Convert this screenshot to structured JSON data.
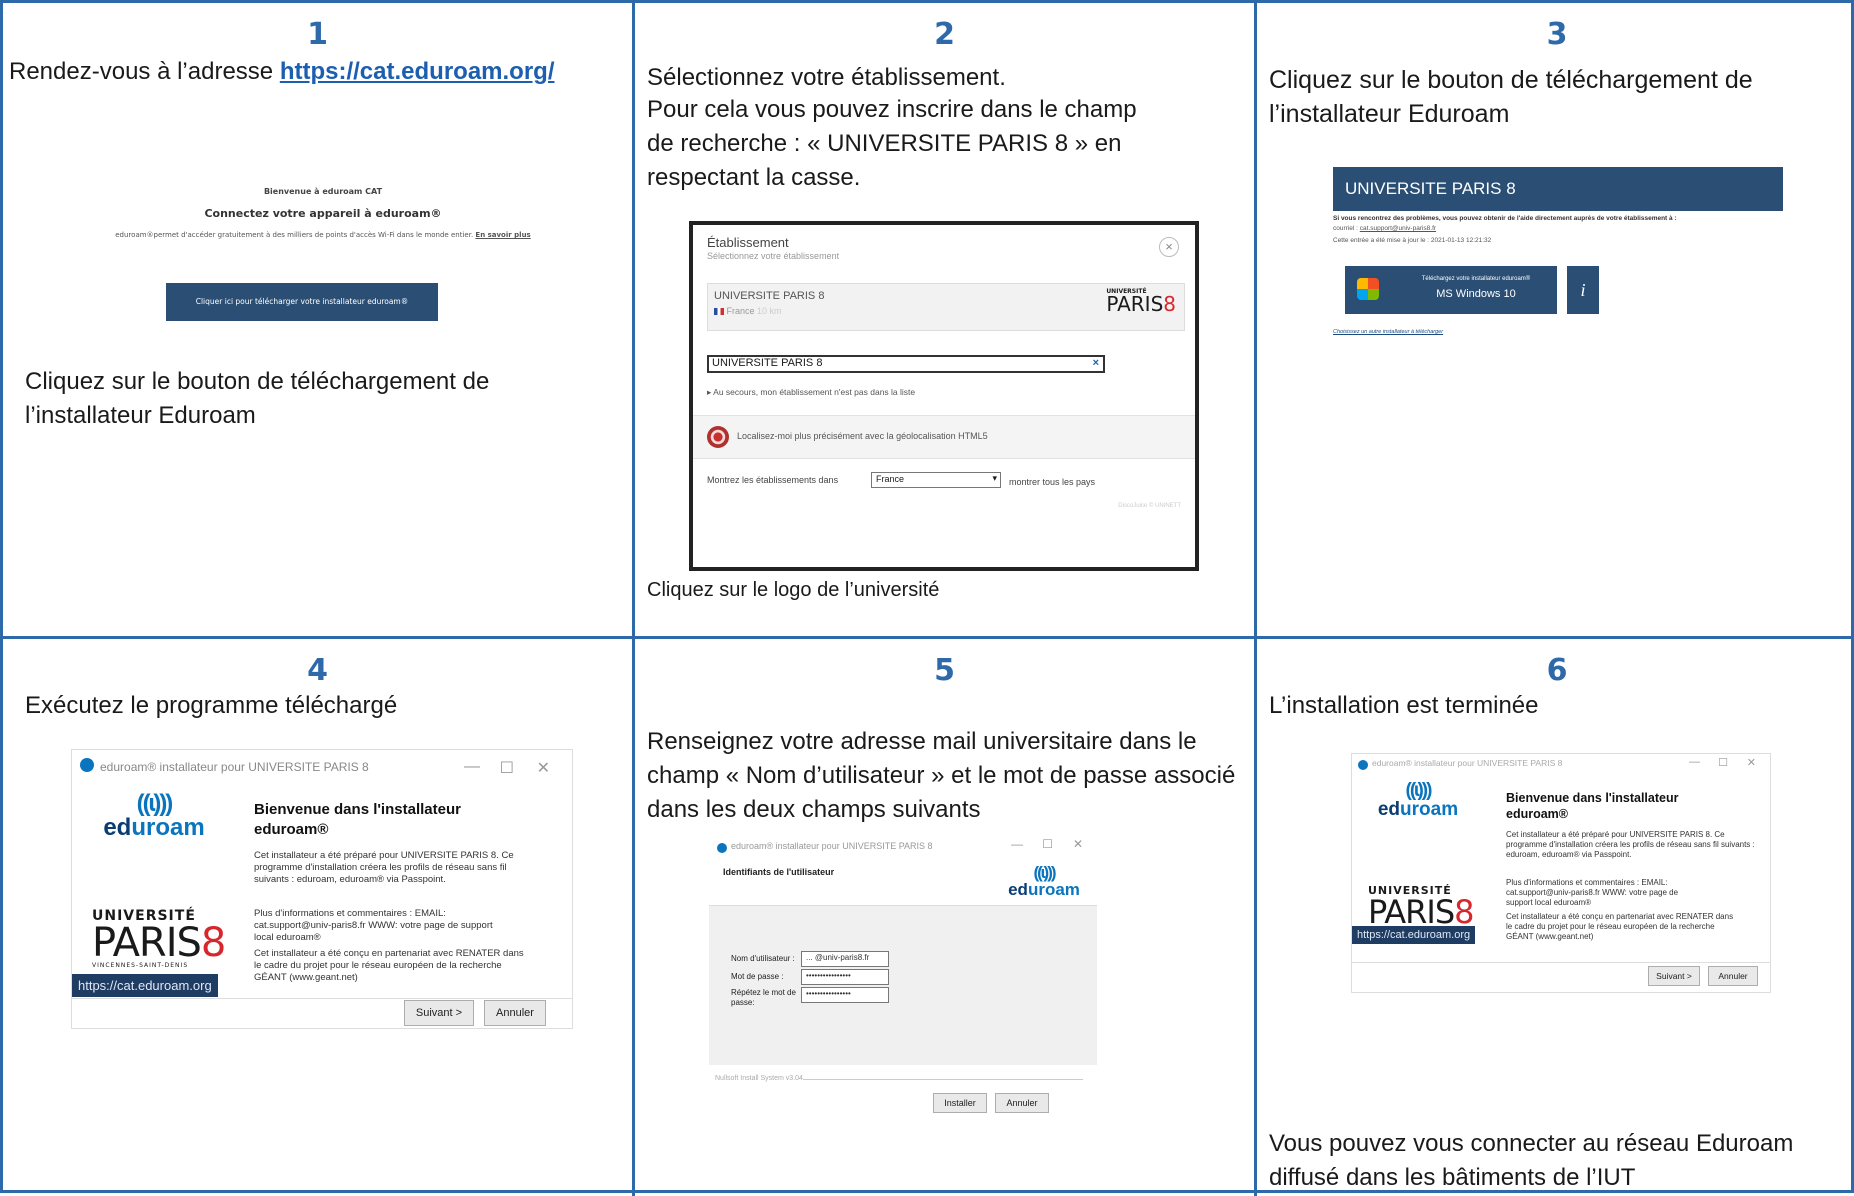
{
  "colors": {
    "accent": "#2e6aa9",
    "link": "#1c5fb0",
    "banner": "#2a4e74",
    "red": "#d8262d"
  },
  "steps": [
    {
      "num": "1",
      "text_prefix": "Rendez-vous à l’adresse ",
      "link": "https://cat.eduroam.org/",
      "text2": "Cliquez sur le bouton de téléchargement de l’installateur Eduroam"
    },
    {
      "num": "2",
      "text": "Sélectionnez votre établissement.",
      "text_b": "Pour cela vous pouvez inscrire dans le champ de recherche : « UNIVERSITE PARIS 8 » en respectant la casse.",
      "caption": "Cliquez sur le logo de l’université"
    },
    {
      "num": "3",
      "text": "Cliquez sur le bouton de téléchargement de l’installateur Eduroam"
    },
    {
      "num": "4",
      "text": "Exécutez le programme téléchargé"
    },
    {
      "num": "5",
      "text": "Renseignez votre adresse mail universitaire dans le champ « Nom d’utilisateur » et le mot de passe associé dans les deux champs suivants"
    },
    {
      "num": "6",
      "text": "L’installation est terminée",
      "text2": "Vous pouvez vous connecter au réseau Eduroam diffusé dans les bâtiments de l’IUT"
    }
  ],
  "shot1": {
    "welcome": "Bienvenue à eduroam CAT",
    "heading": "Connectez votre appareil à eduroam®",
    "desc": "eduroam®permet d'accéder gratuitement à des milliers de points d'accès Wi-Fi dans le monde entier.",
    "more": "En savoir plus",
    "button": "Cliquer ici pour télécharger votre installateur eduroam®"
  },
  "shot2": {
    "title": "Établissement",
    "subtitle": "Sélectionnez votre établissement",
    "close": "×",
    "result_name": "UNIVERSITE PARIS 8",
    "result_country": "France",
    "result_dist": "10 km",
    "search_value": "UNIVERSITE PARIS 8",
    "search_clear": "×",
    "fallback": "Au secours, mon établissement n'est pas dans la liste",
    "geoloc": "Localisez-moi plus précisément avec la géolocalisation HTML5",
    "show_label": "Montrez les établissements dans",
    "country_select": "France",
    "show_all": "montrer tous les pays",
    "footer": "DiscoJuice © UNINETT"
  },
  "shot3": {
    "banner": "UNIVERSITE PARIS 8",
    "help": "Si vous rencontrez des problèmes, vous pouvez obtenir de l'aide directement auprès de votre établissement à :",
    "email_label": "courriel :",
    "email": "cat.support@univ-paris8.fr",
    "updated": "Cette entrée a été mise à jour le : 2021-01-13 12:21:32",
    "dl_small": "Téléchargez votre installateur eduroam®",
    "dl_os": "MS Windows 10",
    "info": "i",
    "other": "Choisissez un autre installateur à télécharger"
  },
  "installer": {
    "title": "eduroam® installateur pour UNIVERSITE PARIS 8",
    "min": "—",
    "max": "☐",
    "close": "✕",
    "heading": "Bienvenue dans l'installateur eduroam®",
    "p1": "Cet installateur a été préparé pour UNIVERSITE PARIS 8. Ce programme d'installation créera les profils de réseau sans fil suivants : eduroam, eduroam® via Passpoint.",
    "p2": "Plus d'informations et commentaires : EMAIL: cat.support@univ-paris8.fr WWW: votre page de support local eduroam®",
    "p3": "Cet installateur a été conçu en partenariat avec RENATER dans le cadre du projet pour le réseau européen de la recherche GÉANT (www.geant.net)",
    "url": "https://cat.eduroam.org",
    "next": "Suivant >",
    "cancel": "Annuler",
    "logo_word_a": "ed",
    "logo_word_b": "uroam",
    "logo_waves": "((ɩ)))",
    "univ": "UNIVERSITÉ",
    "paris": "PARIS",
    "eight": "8",
    "vsd": "VINCENNES-SAINT-DENIS"
  },
  "shot5": {
    "title": "eduroam® installateur pour UNIVERSITE PARIS 8",
    "heading": "Identifiants de l'utilisateur",
    "user_label": "Nom d'utilisateur :",
    "user_value": "...   @univ-paris8.fr",
    "pwd_label": "Mot de passe :",
    "pwd_value": "••••••••••••••••",
    "pwd2_label": "Répétez le mot de passe:",
    "pwd2_value": "••••••••••••••••",
    "nsis": "Nullsoft Install System v3.04",
    "install": "Installer",
    "cancel": "Annuler"
  }
}
